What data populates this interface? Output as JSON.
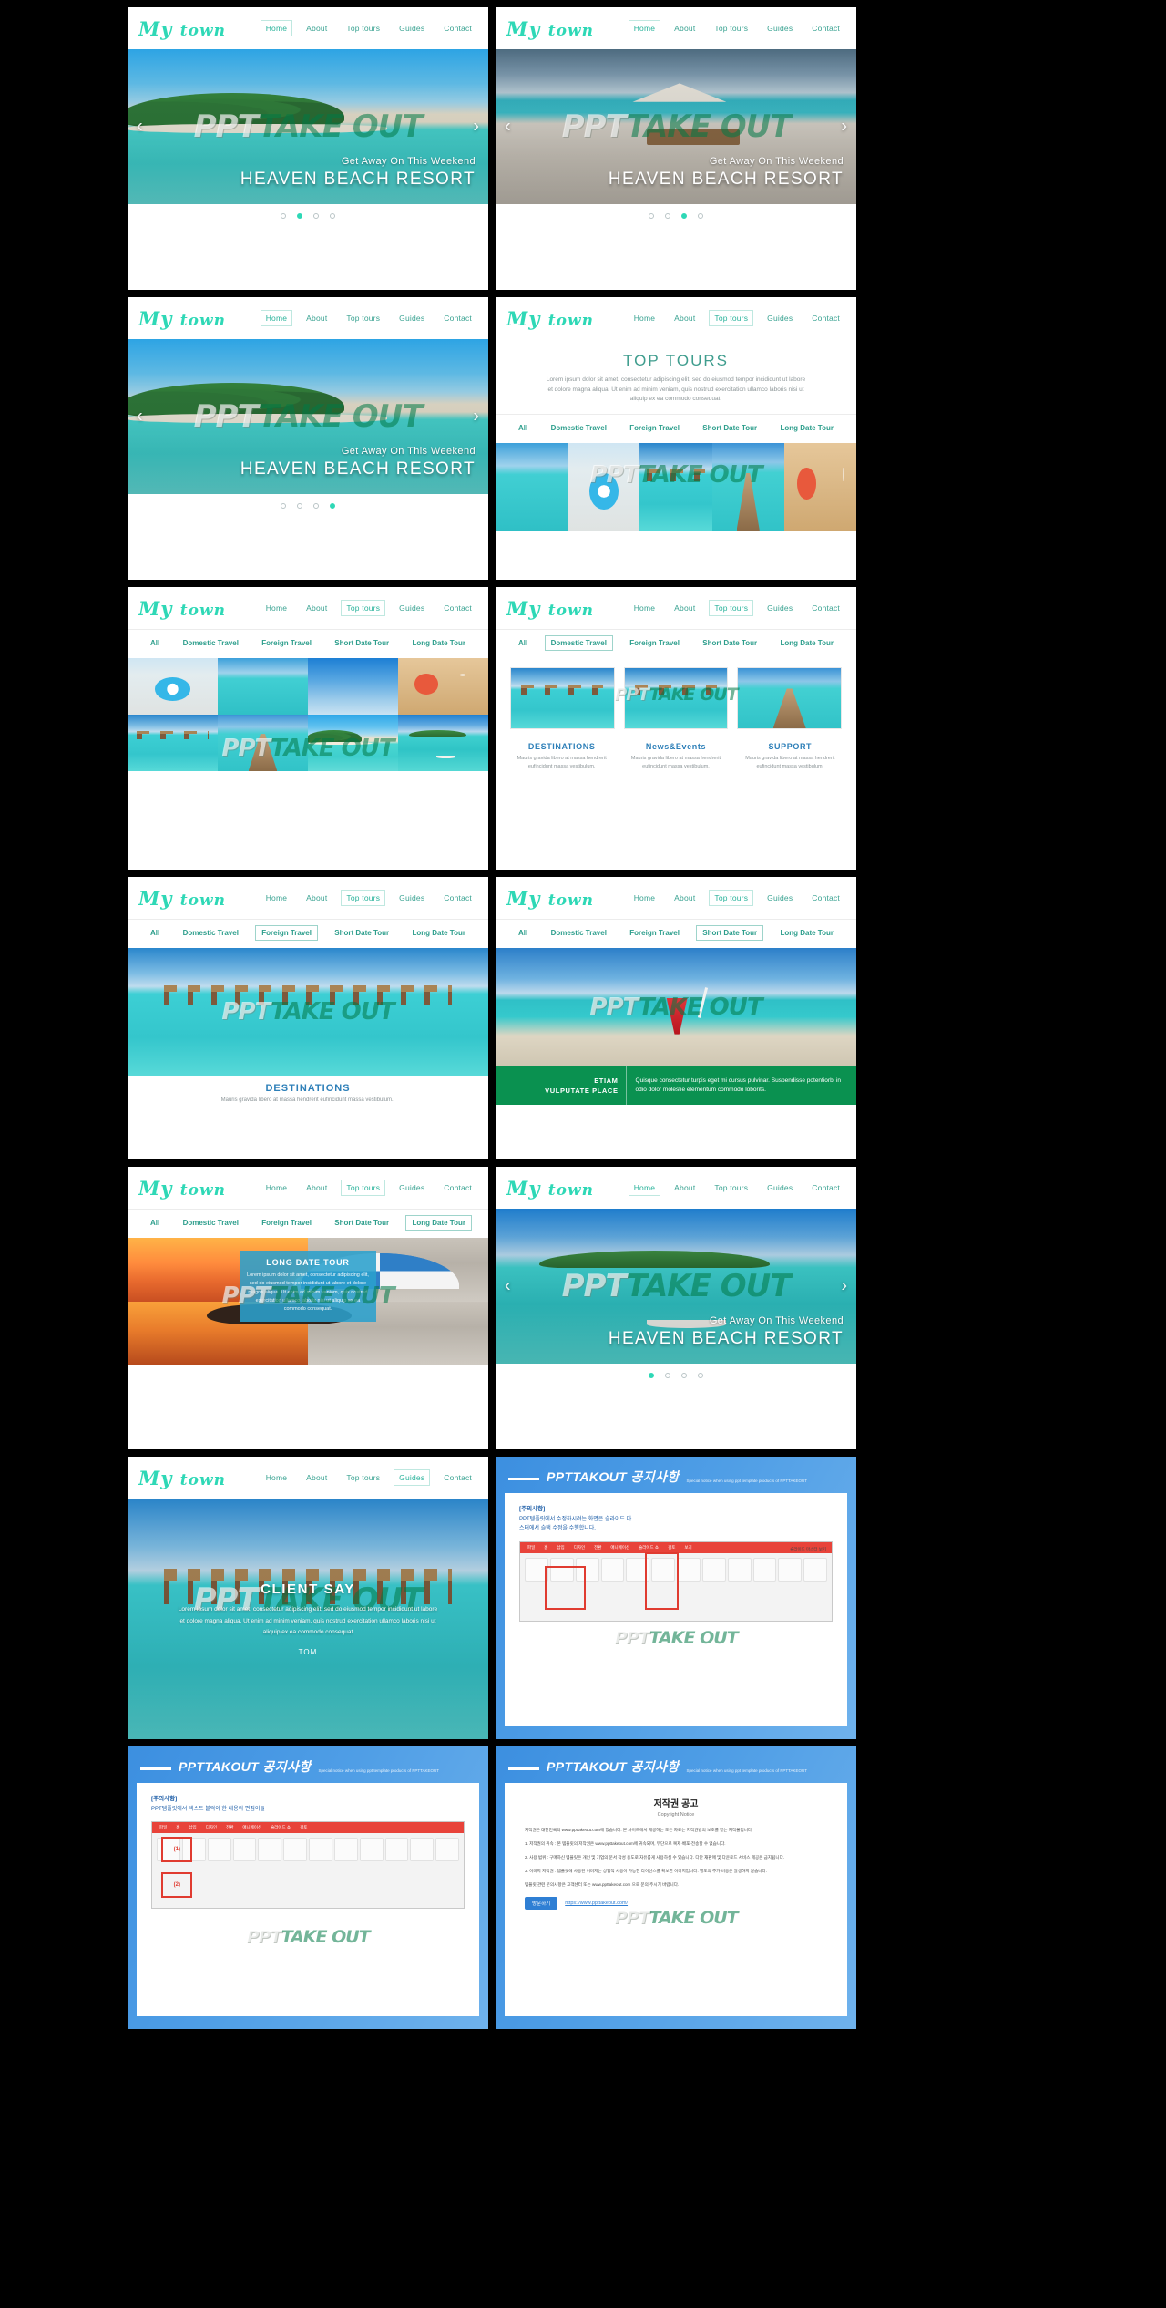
{
  "brand": {
    "logo_main": "My",
    "logo_sub": "town",
    "accent": "#2ed8b6",
    "teal": "#2d9e8c",
    "blue": "#2d7fb8",
    "green": "#0a9150"
  },
  "nav": {
    "items": [
      "Home",
      "About",
      "Top tours",
      "Guides",
      "Contact"
    ]
  },
  "watermark": {
    "part1": "PPT",
    "part2": "TAKE OUT",
    "full": "PPT TAKE OUT"
  },
  "hero": {
    "kicker": "Get Away On This Weekend",
    "title": "HEAVEN BEACH RESORT",
    "arrow_prev": "‹",
    "arrow_next": "›"
  },
  "top_tours": {
    "title": "TOP TOURS",
    "desc": "Lorem ipsum dolor sit amet, consectetur adipiscing elit, sed do eiusmod tempor incididunt ut labore et dolore magna aliqua. Ut enim ad minim veniam, quis nostrud exercitation ullamco laboris nisi ut aliquip ex ea commodo consequat.",
    "filters": [
      "All",
      "Domestic Travel",
      "Foreign Travel",
      "Short Date Tour",
      "Long Date Tour"
    ]
  },
  "cards": [
    {
      "title": "DESTINATIONS",
      "text": "Mauris gravida libero at massa hendrerit eufincidunt massa vestibulum."
    },
    {
      "title": "News&Events",
      "text": "Mauris gravida libero at massa hendrerit eufincidunt massa vestibulum."
    },
    {
      "title": "SUPPORT",
      "text": "Mauris gravida libero at massa hendrerit eufincidunt massa vestibulum."
    }
  ],
  "destinations_wide": {
    "title": "DESTINATIONS",
    "text": "Mauris gravida libero at massa hendrerit eufincidunt massa vestibulum.."
  },
  "etiam": {
    "line1": "ETIAM",
    "line2": "VULPUTATE PLACE",
    "body": "Quisque consectetur turpis eget mi cursus pulvinar. Suspendisse potentiorbi in odio dolor molestie elementum commodo loborits."
  },
  "long_date": {
    "title": "LONG DATE TOUR",
    "text": "Lorem ipsum dolor sit amet, consectetur adipiscing elit, sed do eiusmod tempor incididunt ut labore et dolore magna aliqua. Ut enim ad minim veniam, quis nostrud exercitation ullamco laboris nisi ut aliquip ex ea commodo consequat."
  },
  "client_say": {
    "title": "CLIENT SAY",
    "text": "Lorem ipsum dolor sit amet, consectetur adipiscing elit, sed do eiusmod tempor incididunt ut labore et dolore magna aliqua. Ut enim ad minim veniam, quis nostrud exercitation ullamco laboris nisi ut aliquip ex ea commodo consequat",
    "author": "TOM"
  },
  "notice": {
    "brand_bold": "PPTTAKOUT",
    "title": "공지사항",
    "subtitle": "Special notice when using ppt template products of PPTTAKEOUT",
    "head_label": "[주의사항]",
    "line1": "PPT템플릿에서 수정하시려는 화면은 슬라이드 마",
    "line2": "스터에서 슬택 수정을 수행합니다.",
    "line1b": "[주의사항]",
    "line2b": "PPT템플릿에서 텍스트 블럭이 한 내용의 편집이들",
    "ribbon_tabs": [
      "파일",
      "홈",
      "삽입",
      "디자인",
      "전환",
      "애니메이션",
      "슬라이드 쇼",
      "검토",
      "보기"
    ],
    "ribbon_note": "슬라이드 마스터 보기",
    "step1": "(1)",
    "step2": "(2)",
    "step_label": "슬라이드 마스터"
  },
  "copyright": {
    "brand_bold": "PPTTAKOUT",
    "title_ko": "공지사항",
    "subtitle": "Special notice when using ppt template products of PPTTAKEOUT",
    "heading": "저작권 공고",
    "heading_en": "Copyright Notice",
    "paragraphs": [
      "저작권은 대한민국의 www.ppttakeout.com에 있습니다. 본 사이트에서 제공하는 모든 자료는 저작권법의 보호를 받는 저작물입니다.",
      "1. 저작권의 귀속 : 본 템플릿의 저작권은 www.ppttakeout.com에 귀속되며, 무단으로 복제·배포·전송할 수 없습니다.",
      "2. 사용 범위 : 구매하신 템플릿은 개인 및 기업의 문서 작성 용도로 자유롭게 사용하실 수 있습니다. 다만 재판매 및 다운로드 서비스 제공은 금지됩니다.",
      "3. 이미지 저작권 : 템플릿에 사용된 이미지는 상업적 사용이 가능한 라이선스를 확보한 이미지입니다. 별도의 추가 비용은 발생하지 않습니다.",
      "템플릿 관련 문의사항은 고객센터 또는 www.ppttakeout.com 으로 문의 주시기 바랍니다."
    ],
    "button": "방문하기",
    "link": "https://www.ppttakeout.com/"
  },
  "slides": [
    {
      "index": 1,
      "kind": "hero",
      "active_nav": "Home",
      "active_dot": 1
    },
    {
      "index": 2,
      "kind": "hero",
      "active_nav": "Home",
      "active_dot": 2
    },
    {
      "index": 3,
      "kind": "hero",
      "active_nav": "Home",
      "active_dot": 3
    },
    {
      "index": 4,
      "kind": "tours",
      "active_nav": "Top tours",
      "active_filter": "All"
    },
    {
      "index": 5,
      "kind": "gallery",
      "active_nav": "Top tours",
      "active_filter": "All"
    },
    {
      "index": 6,
      "kind": "cards",
      "active_nav": "Top tours",
      "active_filter": "Domestic Travel"
    },
    {
      "index": 7,
      "kind": "wide",
      "active_nav": "Top tours",
      "active_filter": "Foreign Travel"
    },
    {
      "index": 8,
      "kind": "etiam",
      "active_nav": "Top tours",
      "active_filter": "Short Date Tour"
    },
    {
      "index": 9,
      "kind": "long",
      "active_nav": "Top tours",
      "active_filter": "Long Date Tour"
    },
    {
      "index": 10,
      "kind": "hero",
      "active_nav": "Home",
      "active_dot": 1
    },
    {
      "index": 11,
      "kind": "client",
      "active_nav": "Guides"
    },
    {
      "index": 12,
      "kind": "notice1"
    },
    {
      "index": 13,
      "kind": "notice2"
    },
    {
      "index": 14,
      "kind": "copyright"
    }
  ]
}
